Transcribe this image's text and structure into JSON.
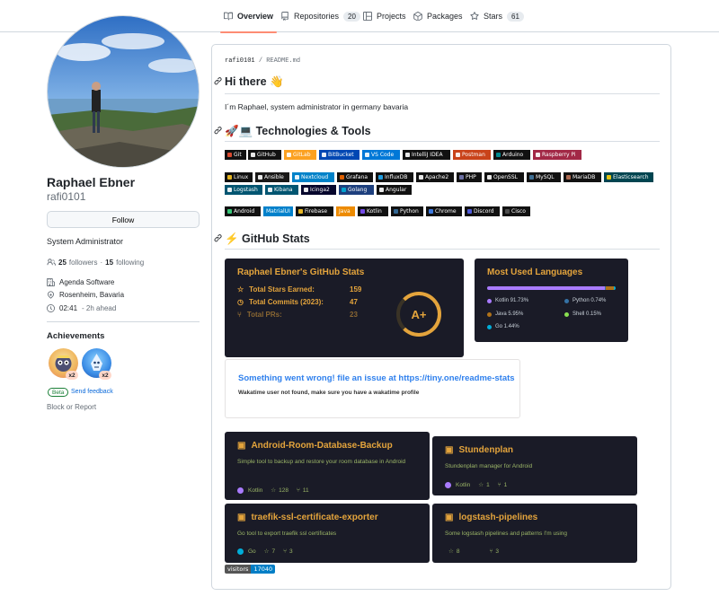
{
  "nav": {
    "tabs": [
      {
        "label": "Overview",
        "icon": "book-icon"
      },
      {
        "label": "Repositories",
        "count": "20",
        "icon": "repo-icon"
      },
      {
        "label": "Projects",
        "icon": "project-icon"
      },
      {
        "label": "Packages",
        "icon": "package-icon"
      },
      {
        "label": "Stars",
        "count": "61",
        "icon": "star-icon"
      }
    ]
  },
  "profile": {
    "name": "Raphael Ebner",
    "login": "rafi0101",
    "follow_label": "Follow",
    "bio": "System Administrator",
    "followers_count": "25",
    "followers_label": "followers",
    "following_count": "15",
    "following_label": "following",
    "company": "Agenda Software",
    "location": "Rosenheim, Bavaria",
    "time": "02:41",
    "time_note": "- 2h ahead",
    "achievements_title": "Achievements",
    "achievements": [
      {
        "count": "x2"
      },
      {
        "count": "x2"
      }
    ],
    "beta_label": "Beta",
    "feedback_label": "Send feedback",
    "block_label": "Block or Report"
  },
  "readme": {
    "owner": "rafi0101",
    "separator": "/",
    "file": "README.md",
    "hi_title": "Hi there 👋",
    "intro": "I´m Raphael, system administrator in germany bavaria",
    "tech_title": "🚀💻 Technologies & Tools",
    "badges_row1": [
      {
        "label": "Git",
        "color": "#111111"
      },
      {
        "label": "GitHub",
        "color": "#111111"
      },
      {
        "label": "GitLab",
        "color": "#fca121"
      },
      {
        "label": "BitBucket",
        "color": "#0047b3"
      },
      {
        "label": "VS Code",
        "color": "#0078d7"
      },
      {
        "label": "IntelliJ IDEA",
        "color": "#111111"
      },
      {
        "label": "Postman",
        "color": "#c9431a"
      },
      {
        "label": "Arduino",
        "color": "#111111"
      },
      {
        "label": "Raspberry Pi",
        "color": "#a22846"
      }
    ],
    "badges_row2": [
      {
        "label": "Linux",
        "color": "#111111"
      },
      {
        "label": "Ansible",
        "color": "#1a1918"
      },
      {
        "label": "Nextcloud",
        "color": "#0082c9"
      },
      {
        "label": "Grafana",
        "color": "#111111"
      },
      {
        "label": "InfluxDB",
        "color": "#111111"
      },
      {
        "label": "Apache2",
        "color": "#111111"
      },
      {
        "label": "PHP",
        "color": "#111111"
      },
      {
        "label": "OpenSSL",
        "color": "#111111"
      },
      {
        "label": "MySQL",
        "color": "#111111"
      },
      {
        "label": "MariaDB",
        "color": "#111111"
      },
      {
        "label": "Elasticsearch",
        "color": "#004550"
      }
    ],
    "badges_row3": [
      {
        "label": "Logstash",
        "color": "#005571"
      },
      {
        "label": "Kibana",
        "color": "#005571"
      },
      {
        "label": "Icinga2",
        "color": "#06062c"
      },
      {
        "label": "Golang",
        "color": "#1d3f7d"
      },
      {
        "label": "Angular",
        "color": "#111111"
      }
    ],
    "badges_row4": [
      {
        "label": "Android",
        "color": "#111111"
      },
      {
        "label": "MatrialUI",
        "color": "#0081cb"
      },
      {
        "label": "Firebase",
        "color": "#111111"
      },
      {
        "label": "Java",
        "color": "#ed8b00"
      },
      {
        "label": "Kotlin",
        "color": "#111111"
      },
      {
        "label": "Python",
        "color": "#111111"
      },
      {
        "label": "Chrome",
        "color": "#111111"
      },
      {
        "label": "Discord",
        "color": "#111111"
      },
      {
        "label": "Cisco",
        "color": "#111111"
      }
    ],
    "stats_title": "⚡ GitHub Stats",
    "stats_card": {
      "title": "Raphael Ebner's GitHub Stats",
      "rows": [
        {
          "label": "Total Stars Earned:",
          "value": "159"
        },
        {
          "label": "Total Commits (2023):",
          "value": "47"
        },
        {
          "label": "Total PRs:",
          "value": "23"
        }
      ],
      "rank": "A+"
    },
    "langs_card": {
      "title": "Most Used Languages",
      "langs": [
        {
          "name": "Kotlin 91.73%",
          "color": "#a97bff",
          "pct": 91.73
        },
        {
          "name": "Python 0.74%",
          "color": "#3572a5",
          "pct": 0.74
        },
        {
          "name": "Java 5.95%",
          "color": "#b07219",
          "pct": 5.95
        },
        {
          "name": "Shell 0.15%",
          "color": "#89e051",
          "pct": 0.15
        },
        {
          "name": "Go 1.44%",
          "color": "#00add8",
          "pct": 1.44
        }
      ]
    },
    "wakatime": {
      "error": "Something went wrong! file an issue at https://tiny.one/readme-stats",
      "detail": "Wakatime user not found, make sure you have a wakatime profile"
    },
    "repos": [
      {
        "name": "Android-Room-Database-Backup",
        "desc": "Simple tool to backup and restore your room database in Android",
        "lang": "Kotlin",
        "lang_color": "#a97bff",
        "stars": "128",
        "forks": "11"
      },
      {
        "name": "Stundenplan",
        "desc": "Stundenplan manager for Android",
        "lang": "Kotlin",
        "lang_color": "#a97bff",
        "stars": "1",
        "forks": "1"
      },
      {
        "name": "traefik-ssl-certificate-exporter",
        "desc": "Go tool to export traefik ssl certificates",
        "lang": "Go",
        "lang_color": "#00add8",
        "stars": "7",
        "forks": "3"
      },
      {
        "name": "logstash-pipelines",
        "desc": "Some logstash pipelines and patterns I'm using",
        "lang": "",
        "lang_color": "",
        "stars": "8",
        "forks": "3"
      }
    ],
    "visitors": {
      "label": "visitors",
      "count": "17040"
    }
  }
}
